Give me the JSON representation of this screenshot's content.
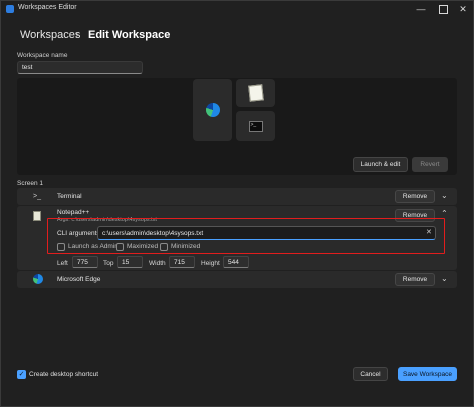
{
  "window": {
    "title": "Workspaces Editor",
    "minimize": "—",
    "close": "✕"
  },
  "breadcrumb": {
    "root": "Workspaces",
    "separator": "›",
    "current": "Edit Workspace"
  },
  "workspace_name": {
    "label": "Workspace name",
    "value": "test"
  },
  "preview": {
    "launch_edit": "Launch & edit",
    "revert": "Revert"
  },
  "screen_label": "Screen 1",
  "apps": [
    {
      "name": "Terminal",
      "remove": "Remove",
      "icon": "terminal-icon"
    },
    {
      "name": "Notepad++",
      "subtitle": "Args: c:\\users\\admin\\desktop\\4sysops.txt",
      "remove": "Remove",
      "icon": "notepad-icon",
      "cli_label": "CLI arguments",
      "cli_value": "c:\\users\\admin\\desktop\\4sysops.txt",
      "cli_clear": "✕",
      "launch_as_admin": "Launch as Admin",
      "maximized": "Maximized",
      "minimized": "Minimized",
      "position": {
        "left_label": "Left",
        "left": "775",
        "top_label": "Top",
        "top": "15",
        "width_label": "Width",
        "width": "715",
        "height_label": "Height",
        "height": "544"
      }
    },
    {
      "name": "Microsoft Edge",
      "remove": "Remove",
      "icon": "edge-icon"
    }
  ],
  "footer": {
    "shortcut_label": "Create desktop shortcut",
    "shortcut_checked": true,
    "cancel": "Cancel",
    "save": "Save Workspace"
  },
  "colors": {
    "accent": "#4aa0ff",
    "highlight": "#e11d1d",
    "background": "#202020"
  }
}
